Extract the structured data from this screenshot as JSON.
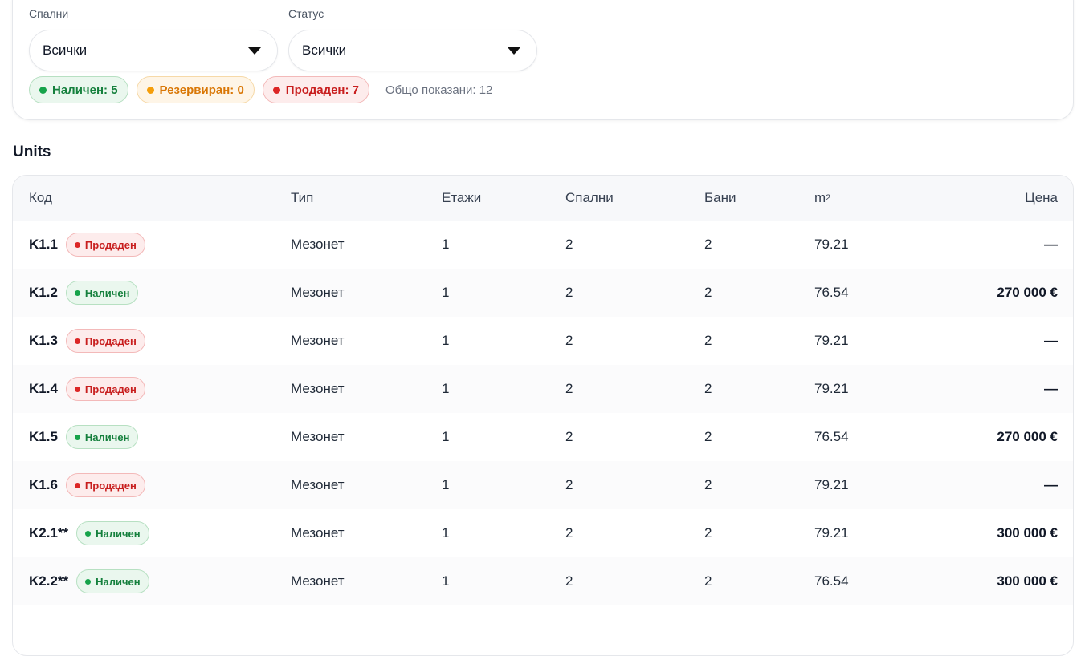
{
  "filters": {
    "bedrooms": {
      "label": "Спални",
      "value": "Всички"
    },
    "status": {
      "label": "Статус",
      "value": "Всички"
    }
  },
  "summary": {
    "available": "Наличен: 5",
    "reserved": "Резервиран: 0",
    "sold": "Продаден: 7",
    "total": "Общо показани: 12"
  },
  "section_title": "Units",
  "table": {
    "headers": {
      "code": "Код",
      "type": "Тип",
      "floors": "Етажи",
      "bedrooms": "Спални",
      "bathrooms": "Бани",
      "area": "m",
      "area_sup": "2",
      "price": "Цена"
    },
    "rows": [
      {
        "code": "K1.1",
        "status": "Продаден",
        "status_kind": "sold",
        "type": "Мезонет",
        "floors": "1",
        "bedrooms": "2",
        "bathrooms": "2",
        "area": "79.21",
        "price": "—"
      },
      {
        "code": "K1.2",
        "status": "Наличен",
        "status_kind": "avail",
        "type": "Мезонет",
        "floors": "1",
        "bedrooms": "2",
        "bathrooms": "2",
        "area": "76.54",
        "price": "270 000 €"
      },
      {
        "code": "K1.3",
        "status": "Продаден",
        "status_kind": "sold",
        "type": "Мезонет",
        "floors": "1",
        "bedrooms": "2",
        "bathrooms": "2",
        "area": "79.21",
        "price": "—"
      },
      {
        "code": "K1.4",
        "status": "Продаден",
        "status_kind": "sold",
        "type": "Мезонет",
        "floors": "1",
        "bedrooms": "2",
        "bathrooms": "2",
        "area": "79.21",
        "price": "—"
      },
      {
        "code": "K1.5",
        "status": "Наличен",
        "status_kind": "avail",
        "type": "Мезонет",
        "floors": "1",
        "bedrooms": "2",
        "bathrooms": "2",
        "area": "76.54",
        "price": "270 000 €"
      },
      {
        "code": "K1.6",
        "status": "Продаден",
        "status_kind": "sold",
        "type": "Мезонет",
        "floors": "1",
        "bedrooms": "2",
        "bathrooms": "2",
        "area": "79.21",
        "price": "—"
      },
      {
        "code": "K2.1**",
        "status": "Наличен",
        "status_kind": "avail",
        "type": "Мезонет",
        "floors": "1",
        "bedrooms": "2",
        "bathrooms": "2",
        "area": "79.21",
        "price": "300 000 €"
      },
      {
        "code": "K2.2**",
        "status": "Наличен",
        "status_kind": "avail",
        "type": "Мезонет",
        "floors": "1",
        "bedrooms": "2",
        "bathrooms": "2",
        "area": "76.54",
        "price": "300 000 €"
      }
    ]
  },
  "colors": {
    "available": "#16a34a",
    "reserved": "#f59e0b",
    "sold": "#dc2626"
  }
}
